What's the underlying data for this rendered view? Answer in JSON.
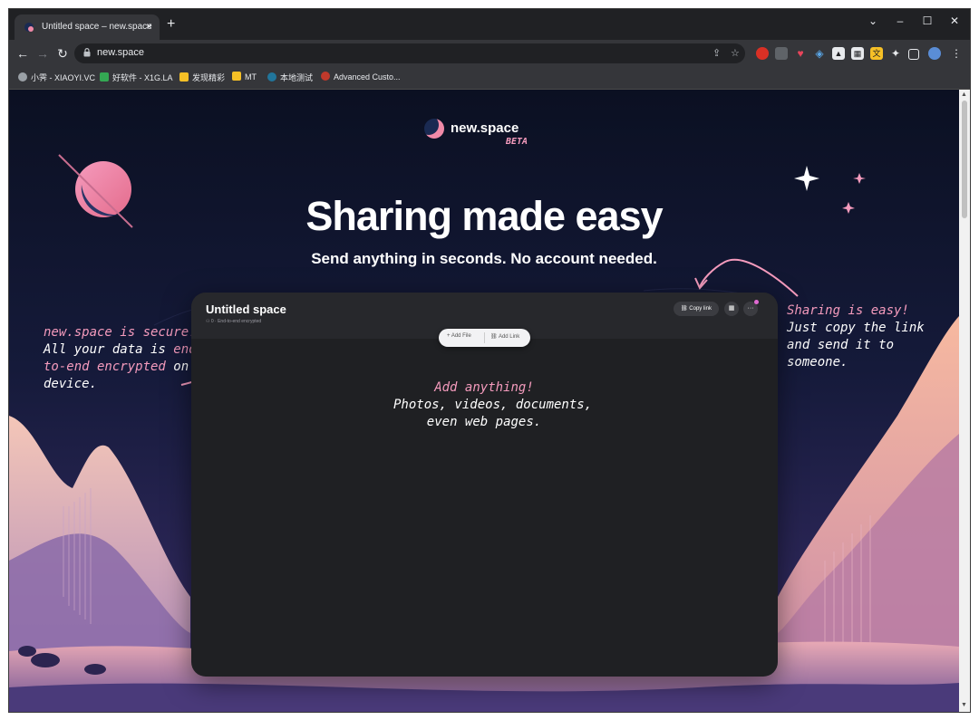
{
  "browser": {
    "tab_title": "Untitled space – new.space",
    "tab_close": "×",
    "new_tab": "+",
    "window_controls": [
      "⌄",
      "–",
      "☐",
      "✕"
    ],
    "nav": {
      "back": "←",
      "forward": "→",
      "reload": "↻"
    },
    "url": "new.space",
    "bookmarks": [
      {
        "label": "小霁 - XIAOYI.VC",
        "color": "#9aa0a6"
      },
      {
        "label": "好软件 - X1G.LA",
        "color": "#34a853"
      },
      {
        "label": "发现精彩",
        "color": "#f6c026"
      },
      {
        "label": "MT",
        "color": "#f6c026"
      },
      {
        "label": "本地测试",
        "color": "#21759b"
      },
      {
        "label": "Advanced Custo...",
        "color": "#c0392b"
      }
    ]
  },
  "page": {
    "logo_name": "new.space",
    "logo_badge": "BETA",
    "headline": "Sharing made easy",
    "subheadline": "Send anything in seconds. No account needed.",
    "space": {
      "title": "Untitled space",
      "meta": "⚇ 0  ·  End-to-end encrypted",
      "copy_link": "⛓ Copy link",
      "qr_button": "▦",
      "more_button": "···",
      "add_file": "+ Add File",
      "add_link": "⛓ Add Link"
    },
    "note_left": {
      "line1": "new.space is secure!",
      "line2a": "All your data is ",
      "line2b": "end-",
      "line3a": "to-end encrypted",
      "line3b": " on",
      "line4": "device."
    },
    "note_center": {
      "line1": "Add anything!",
      "line2": "Photos, videos, documents,",
      "line3": "even web pages."
    },
    "note_right": {
      "line1": "Sharing is easy!",
      "line2": "Just copy the link",
      "line3": "and send it to",
      "line4": "someone."
    }
  },
  "colors": {
    "accent_pink": "#f59bbd",
    "sky_top": "#0b1022",
    "sky_bottom": "#3a2e6a",
    "panel": "#1f2023"
  }
}
